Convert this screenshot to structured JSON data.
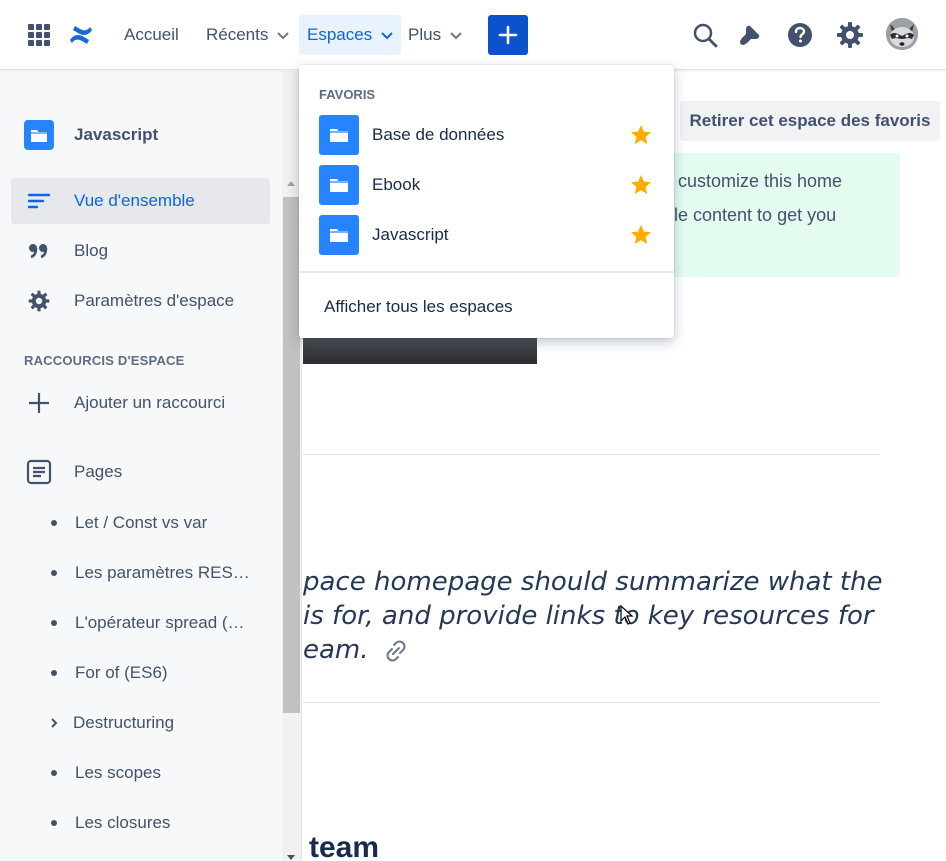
{
  "topnav": {
    "home_label": "Accueil",
    "recent_label": "Récents",
    "spaces_label": "Espaces",
    "more_label": "Plus",
    "create_label": "+",
    "icons": [
      "app-switcher-icon",
      "confluence-logo-icon",
      "search-icon",
      "notifications-icon",
      "help-icon",
      "settings-icon"
    ]
  },
  "sidebar": {
    "space_name": "Javascript",
    "items": [
      {
        "label": "Vue d'ensemble",
        "icon": "overview-icon",
        "selected": true
      },
      {
        "label": "Blog",
        "icon": "quote-icon",
        "selected": false
      },
      {
        "label": "Paramètres d'espace",
        "icon": "gear-icon",
        "selected": false
      }
    ],
    "shortcuts_heading": "RACCOURCIS D'ESPACE",
    "add_shortcut_label": "Ajouter un raccourci",
    "pages_label": "Pages",
    "pages": [
      {
        "label": "Let / Const vs var",
        "marker": "bullet"
      },
      {
        "label": "Les paramètres RES…",
        "marker": "bullet"
      },
      {
        "label": "L'opérateur spread (…",
        "marker": "bullet"
      },
      {
        "label": "For of (ES6)",
        "marker": "bullet"
      },
      {
        "label": "Destructuring",
        "marker": "caret"
      },
      {
        "label": "Les scopes",
        "marker": "bullet"
      },
      {
        "label": "Les closures",
        "marker": "bullet"
      }
    ]
  },
  "main": {
    "unfavorite_button": "Retirer cet espace des favoris",
    "info_line1": "customize this home",
    "info_line2": "le content to get you",
    "quote_line1": "pace homepage should summarize what the",
    "quote_line2": "is for, and provide links to key resources for",
    "quote_line3": "eam.",
    "team_heading": "team"
  },
  "dropdown": {
    "heading": "FAVORIS",
    "items": [
      {
        "label": "Base de données",
        "starred": true
      },
      {
        "label": "Ebook",
        "starred": true
      },
      {
        "label": "Javascript",
        "starred": true
      }
    ],
    "view_all_label": "Afficher tous les espaces"
  },
  "colors": {
    "accent": "#0c66e4",
    "create_button": "#0c52cc",
    "space_icon": "#2684ff",
    "star": "#ffab00",
    "info_panel": "#e3fcef"
  }
}
